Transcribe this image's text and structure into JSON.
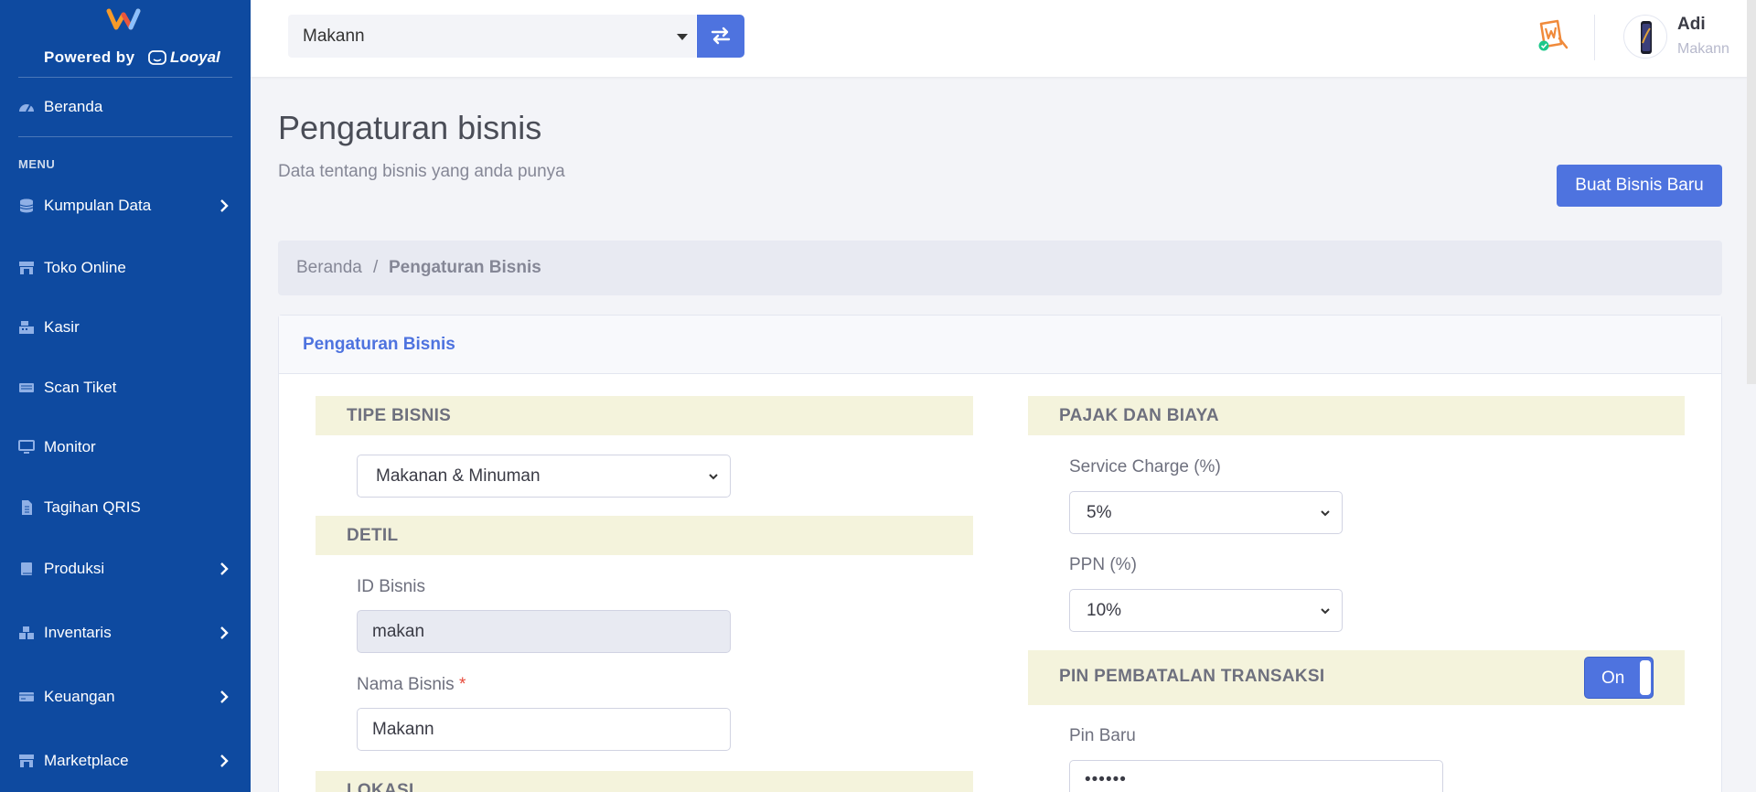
{
  "brand": {
    "powered_by": "Powered by",
    "partner": "Looyal"
  },
  "sidebar": {
    "home": "Beranda",
    "menu_heading": "MENU",
    "items": [
      {
        "label": "Kumpulan Data",
        "icon": "database-icon",
        "has_submenu": true
      },
      {
        "label": "Toko Online",
        "icon": "store-icon",
        "has_submenu": false
      },
      {
        "label": "Kasir",
        "icon": "cash-register-icon",
        "has_submenu": false
      },
      {
        "label": "Scan Tiket",
        "icon": "ticket-icon",
        "has_submenu": false
      },
      {
        "label": "Monitor",
        "icon": "monitor-icon",
        "has_submenu": false
      },
      {
        "label": "Tagihan QRIS",
        "icon": "invoice-icon",
        "has_submenu": false
      },
      {
        "label": "Produksi",
        "icon": "book-icon",
        "has_submenu": true
      },
      {
        "label": "Inventaris",
        "icon": "boxes-icon",
        "has_submenu": true
      },
      {
        "label": "Keuangan",
        "icon": "money-icon",
        "has_submenu": true
      },
      {
        "label": "Marketplace",
        "icon": "store-icon",
        "has_submenu": true
      }
    ]
  },
  "topbar": {
    "business_select": "Makann",
    "user": {
      "name": "Adi",
      "business": "Makann"
    }
  },
  "page": {
    "title": "Pengaturan bisnis",
    "subtitle": "Data tentang bisnis yang anda punya",
    "new_button": "Buat Bisnis Baru",
    "breadcrumb": {
      "home": "Beranda",
      "separator": "/",
      "current": "Pengaturan Bisnis"
    }
  },
  "card": {
    "title": "Pengaturan Bisnis",
    "left": {
      "type_section": "TIPE BISNIS",
      "type_value": "Makanan & Minuman",
      "detail_section": "DETIL",
      "id_label": "ID Bisnis",
      "id_value": "makan",
      "name_label": "Nama Bisnis",
      "name_required": "*",
      "name_value": "Makann",
      "location_section": "LOKASI"
    },
    "right": {
      "tax_section": "PAJAK DAN BIAYA",
      "service_label": "Service Charge (%)",
      "service_value": "5%",
      "ppn_label": "PPN (%)",
      "ppn_value": "10%",
      "pin_section": "PIN PEMBATALAN TRANSAKSI",
      "pin_toggle": "On",
      "pin_label": "Pin Baru",
      "pin_value": "••••••"
    }
  },
  "colors": {
    "sidebar": "#0e4aa0",
    "primary": "#4e73df",
    "section_bg": "#f4f3dc"
  }
}
